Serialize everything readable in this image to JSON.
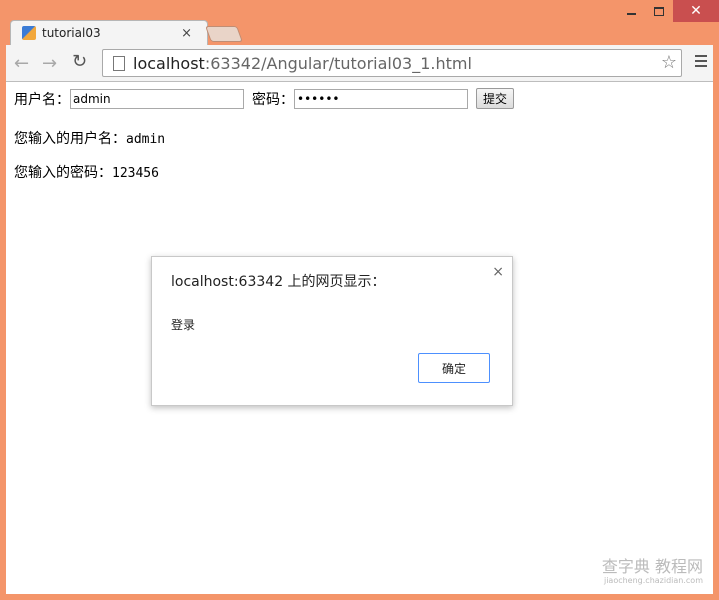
{
  "browser": {
    "tab_title": "tutorial03",
    "tab_close": "×",
    "url_host": "localhost",
    "url_rest": ":63342/Angular/tutorial03_1.html"
  },
  "form": {
    "username_label": "用户名：",
    "username_value": "admin",
    "password_label": "密码：",
    "password_value": "••••••",
    "submit_label": "提交"
  },
  "output": {
    "username_prefix": "您输入的用户名：",
    "username_value": "admin",
    "password_prefix": "您输入的密码：",
    "password_value": "123456"
  },
  "dialog": {
    "title": "localhost:63342 上的网页显示：",
    "close": "×",
    "message": "登录",
    "ok_label": "确定"
  },
  "watermark": {
    "main": "查字典 教程网",
    "sub": "jiaocheng.chazidian.com"
  }
}
